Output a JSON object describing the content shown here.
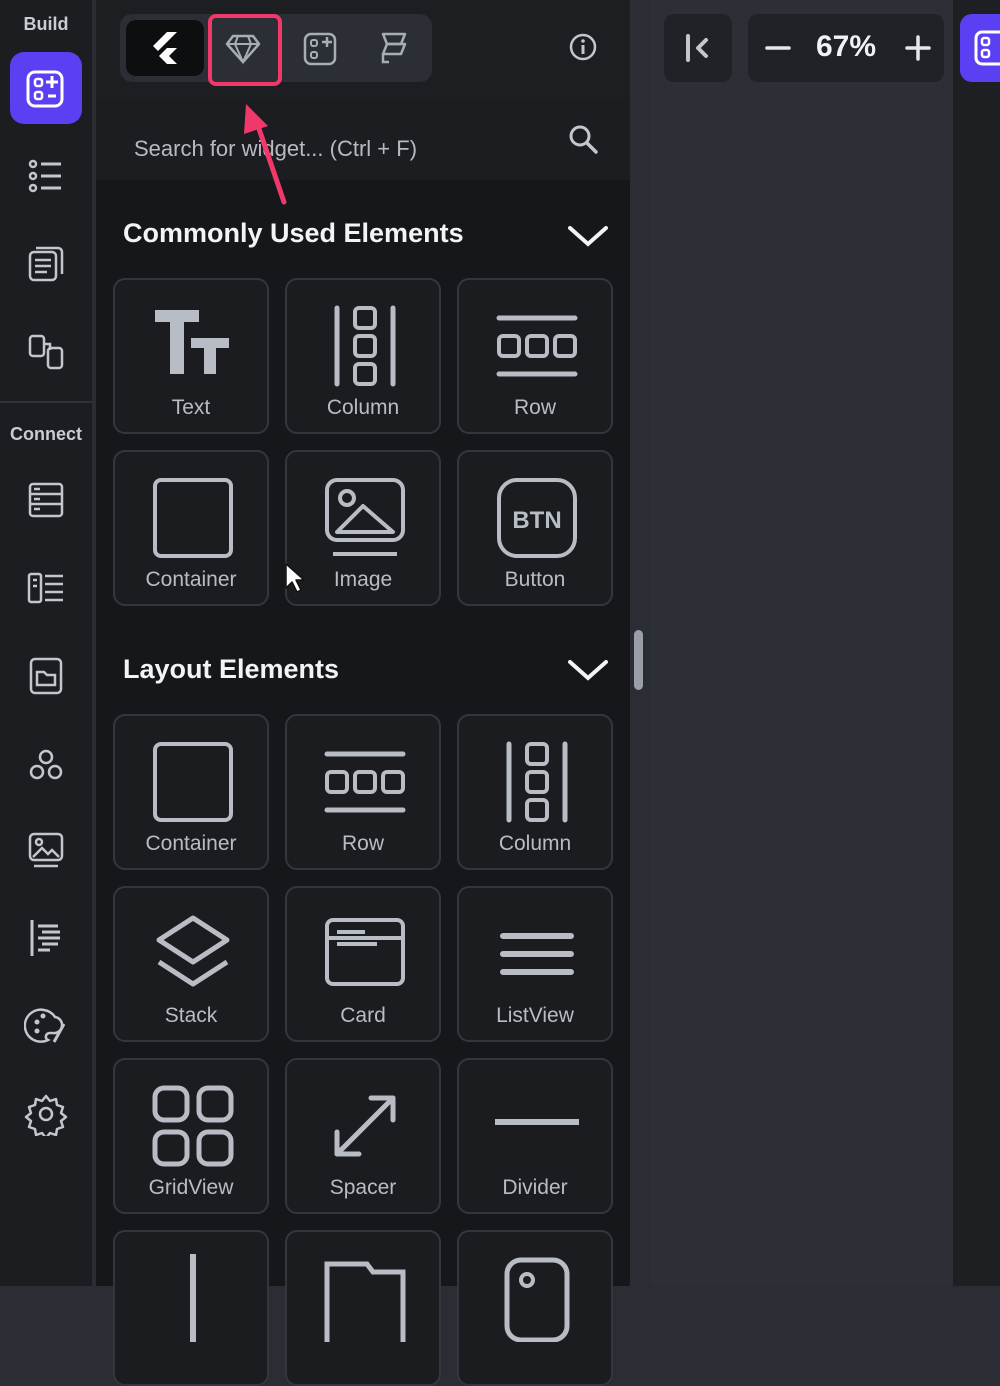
{
  "rail": {
    "build_label": "Build",
    "connect_label": "Connect",
    "items_top": [
      "widget-builder-icon",
      "widget-tree-icon",
      "pages-icon",
      "navigation-icon"
    ],
    "items_bottom": [
      "firestore-icon",
      "api-icon",
      "storage-icon",
      "integrations-icon",
      "media-assets-icon",
      "text-styles-icon",
      "theme-icon",
      "settings-icon"
    ],
    "accent": "#5b3ff2"
  },
  "panel": {
    "search_placeholder": "Search for widget... (Ctrl + F)",
    "sections": [
      {
        "title": "Commonly Used Elements",
        "items": [
          "Text",
          "Column",
          "Row",
          "Container",
          "Image",
          "Button"
        ]
      },
      {
        "title": "Layout Elements",
        "items": [
          "Container",
          "Row",
          "Column",
          "Stack",
          "Card",
          "ListView",
          "GridView",
          "Spacer",
          "Divider"
        ]
      }
    ],
    "button_icon_text": "BTN",
    "highlight_color": "#f0386b"
  },
  "canvas": {
    "zoom_level": "67%"
  }
}
